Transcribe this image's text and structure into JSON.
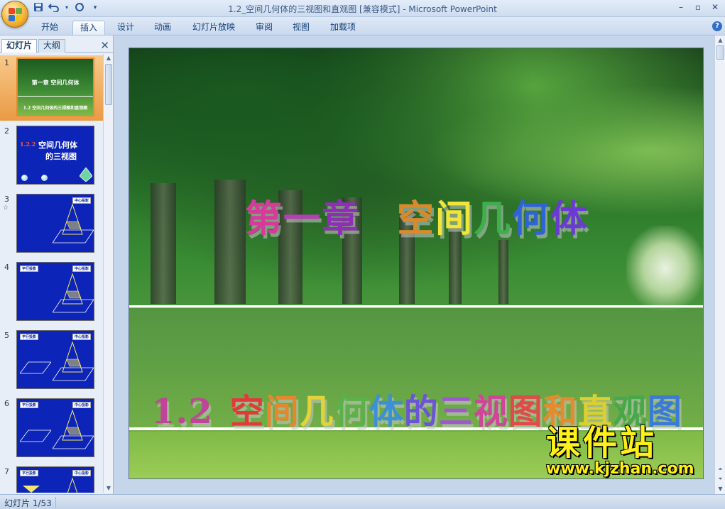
{
  "window": {
    "title": "1.2_空间几何体的三视图和直观图 [兼容模式] - Microsoft PowerPoint"
  },
  "quick_access": {
    "save_icon": "save-icon",
    "undo_icon": "undo-icon",
    "redo_icon": "redo-icon",
    "customize_icon": "customize-qat-icon"
  },
  "window_controls": {
    "minimize": "–",
    "restore": "▫",
    "close": "✕"
  },
  "ribbon": {
    "tabs": [
      "开始",
      "插入",
      "设计",
      "动画",
      "幻灯片放映",
      "审阅",
      "视图",
      "加载项"
    ],
    "active_tab": "插入",
    "help_label": "?"
  },
  "left_pane": {
    "tab_slides": "幻灯片",
    "tab_outline": "大纲",
    "close_label": "✕",
    "slides": [
      {
        "number": "1",
        "selected": true,
        "title": "第一章 空间几何体",
        "subtitle": "1.2 空间几何体的三视图和直观图"
      },
      {
        "number": "2",
        "selected": false,
        "title_num": "1.2.2",
        "title_text": "空间几何体",
        "title_text2": "的三视图"
      },
      {
        "number": "3",
        "selected": false,
        "has_animation": true,
        "tag_right": "中心投影"
      },
      {
        "number": "4",
        "selected": false,
        "tag_left": "平行投影",
        "tag_right": "中心投影"
      },
      {
        "number": "5",
        "selected": false,
        "tag_left": "平行投影",
        "tag_right": "中心投影"
      },
      {
        "number": "6",
        "selected": false,
        "tag_left": "平行投影",
        "tag_right": "中心投影"
      },
      {
        "number": "7",
        "selected": false,
        "tag_left": "平行投影",
        "tag_right": "中心投影"
      }
    ],
    "animation_icon": "☆"
  },
  "slide": {
    "title_line": "第一章  空间几何体",
    "subtitle_line": "1.2 空间几何体的三视图和直观图",
    "title_colors": [
      "#d63a9a",
      "#b33fb0",
      "#8e2fb5",
      "#d98a2a",
      "#f1e53a",
      "#3fae4c",
      "#2f63d6",
      "#6b3bd0",
      "#a23ad0"
    ],
    "subtitle_colors": [
      "#c0459a",
      "#c0459a",
      "#c0459a",
      "#e23a3a",
      "#e5872d",
      "#e3d33a",
      "#5ab24a",
      "#3d8fd6",
      "#6b55d4",
      "#a055d4",
      "#d0459a",
      "#e24a4a",
      "#e88a2c",
      "#dccf30",
      "#46a84a",
      "#3a7ad8",
      "#7050d0"
    ]
  },
  "watermark": {
    "chinese": "课件站",
    "url": "www.kjzhan.com"
  },
  "status_bar": {
    "slide_counter": "幻灯片 1/53"
  }
}
